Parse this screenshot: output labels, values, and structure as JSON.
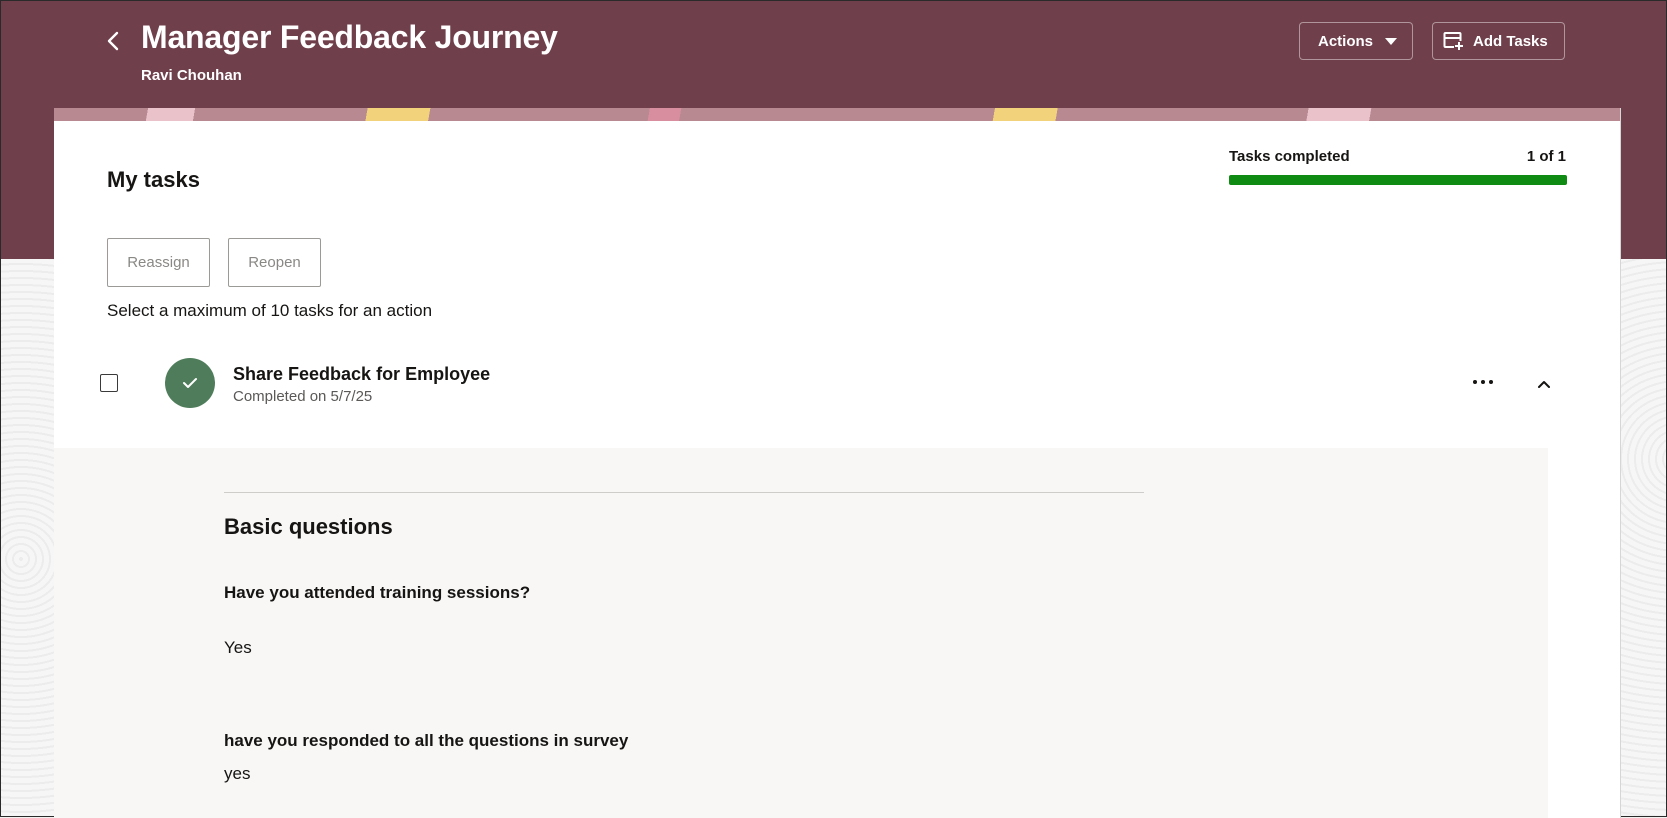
{
  "header": {
    "title": "Manager Feedback Journey",
    "subtitle": "Ravi Chouhan",
    "actions_label": "Actions",
    "add_tasks_label": "Add Tasks"
  },
  "tasks_section": {
    "title": "My tasks",
    "progress": {
      "label": "Tasks completed",
      "count_text": "1 of 1",
      "completed": 1,
      "total": 1
    },
    "buttons": {
      "reassign": "Reassign",
      "reopen": "Reopen"
    },
    "hint": "Select a maximum of 10 tasks for an action"
  },
  "task": {
    "title": "Share Feedback for Employee",
    "status": "Completed on 5/7/25",
    "status_color": "#4f7d5b"
  },
  "details": {
    "section_title": "Basic questions",
    "questions": [
      {
        "label": "Have you attended training sessions?",
        "answer": "Yes"
      },
      {
        "label": "have you responded to all the questions in survey",
        "answer": "yes"
      }
    ]
  },
  "colors": {
    "header_bg": "#6f3f4b",
    "progress_fill": "#0f8a12"
  }
}
